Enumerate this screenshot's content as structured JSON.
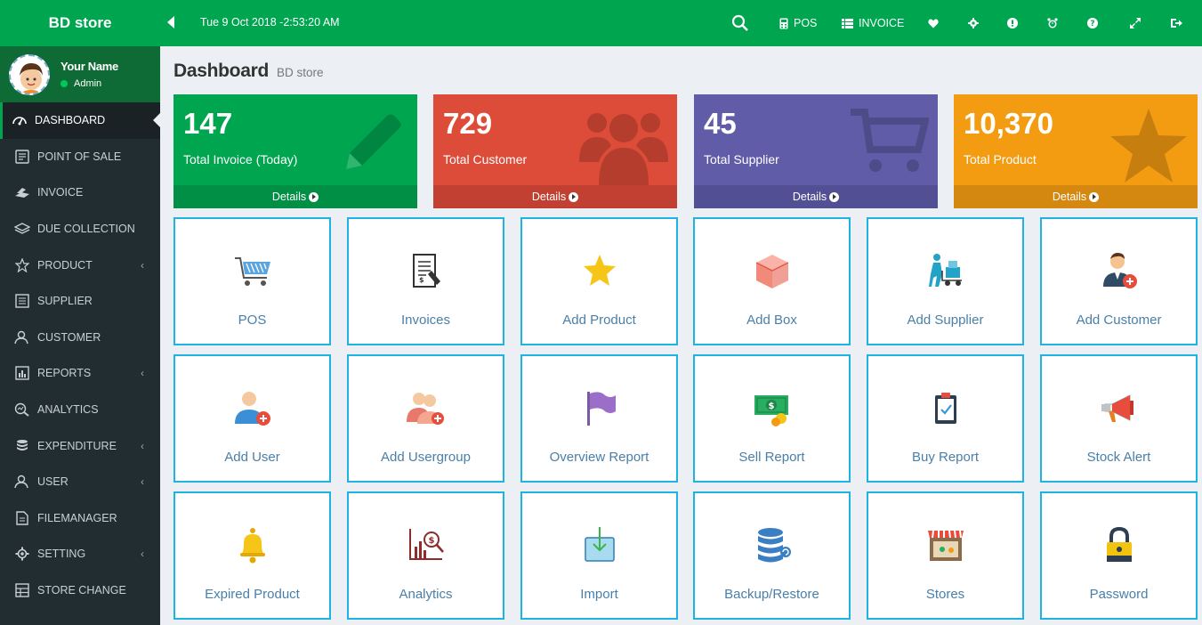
{
  "brand": "BD store",
  "user": {
    "name": "Your Name",
    "role": "Admin"
  },
  "sidebar": {
    "items": [
      {
        "label": "DASHBOARD",
        "icon": "dashboard-icon",
        "active": true,
        "arrow": false
      },
      {
        "label": "POINT OF SALE",
        "icon": "pos-icon",
        "arrow": false
      },
      {
        "label": "INVOICE",
        "icon": "invoice-icon",
        "arrow": false
      },
      {
        "label": "DUE COLLECTION",
        "icon": "money-icon",
        "arrow": false
      },
      {
        "label": "PRODUCT",
        "icon": "star-icon",
        "arrow": true
      },
      {
        "label": "SUPPLIER",
        "icon": "supplier-icon",
        "arrow": false
      },
      {
        "label": "CUSTOMER",
        "icon": "customer-icon",
        "arrow": false
      },
      {
        "label": "REPORTS",
        "icon": "reports-icon",
        "arrow": true
      },
      {
        "label": "ANALYTICS",
        "icon": "analytics-icon",
        "arrow": false
      },
      {
        "label": "EXPENDITURE",
        "icon": "database-icon",
        "arrow": true
      },
      {
        "label": "USER",
        "icon": "user-icon",
        "arrow": true
      },
      {
        "label": "FILEMANAGER",
        "icon": "file-icon",
        "arrow": false
      },
      {
        "label": "SETTING",
        "icon": "gear-icon",
        "arrow": true
      },
      {
        "label": "STORE CHANGE",
        "icon": "table-icon",
        "arrow": false
      }
    ]
  },
  "header": {
    "datetime": "Tue 9 Oct 2018 -2:53:20 AM",
    "pos_label": "POS",
    "invoice_label": "INVOICE"
  },
  "page": {
    "title": "Dashboard",
    "subtitle": "BD store"
  },
  "stats": [
    {
      "value": "147",
      "label": "Total Invoice (Today)",
      "footer": "Details",
      "color": "#00a54f",
      "footer_color": "#008f44",
      "icon": "pencil-icon"
    },
    {
      "value": "729",
      "label": "Total Customer",
      "footer": "Details",
      "color": "#dd4b39",
      "footer_color": "#c24032",
      "icon": "users-icon"
    },
    {
      "value": "45",
      "label": "Total Supplier",
      "footer": "Details",
      "color": "#605ca8",
      "footer_color": "#534f95",
      "icon": "cart-icon"
    },
    {
      "value": "10,370",
      "label": "Total Product",
      "footer": "Details",
      "color": "#f39c12",
      "footer_color": "#d58810",
      "icon": "star-icon"
    }
  ],
  "tiles": [
    {
      "label": "POS",
      "icon": "shopping-cart-icon"
    },
    {
      "label": "Invoices",
      "icon": "receipt-icon"
    },
    {
      "label": "Add Product",
      "icon": "star-icon"
    },
    {
      "label": "Add Box",
      "icon": "box-icon"
    },
    {
      "label": "Add Supplier",
      "icon": "delivery-icon"
    },
    {
      "label": "Add Customer",
      "icon": "add-customer-icon"
    },
    {
      "label": "Add User",
      "icon": "add-user-icon"
    },
    {
      "label": "Add Usergroup",
      "icon": "add-usergroup-icon"
    },
    {
      "label": "Overview Report",
      "icon": "flag-icon"
    },
    {
      "label": "Sell Report",
      "icon": "cash-icon"
    },
    {
      "label": "Buy Report",
      "icon": "clipboard-icon"
    },
    {
      "label": "Stock Alert",
      "icon": "megaphone-icon"
    },
    {
      "label": "Expired Product",
      "icon": "bell-icon"
    },
    {
      "label": "Analytics",
      "icon": "analytics-chart-icon"
    },
    {
      "label": "Import",
      "icon": "import-icon"
    },
    {
      "label": "Backup/Restore",
      "icon": "database-icon"
    },
    {
      "label": "Stores",
      "icon": "store-icon"
    },
    {
      "label": "Password",
      "icon": "lock-icon"
    }
  ]
}
